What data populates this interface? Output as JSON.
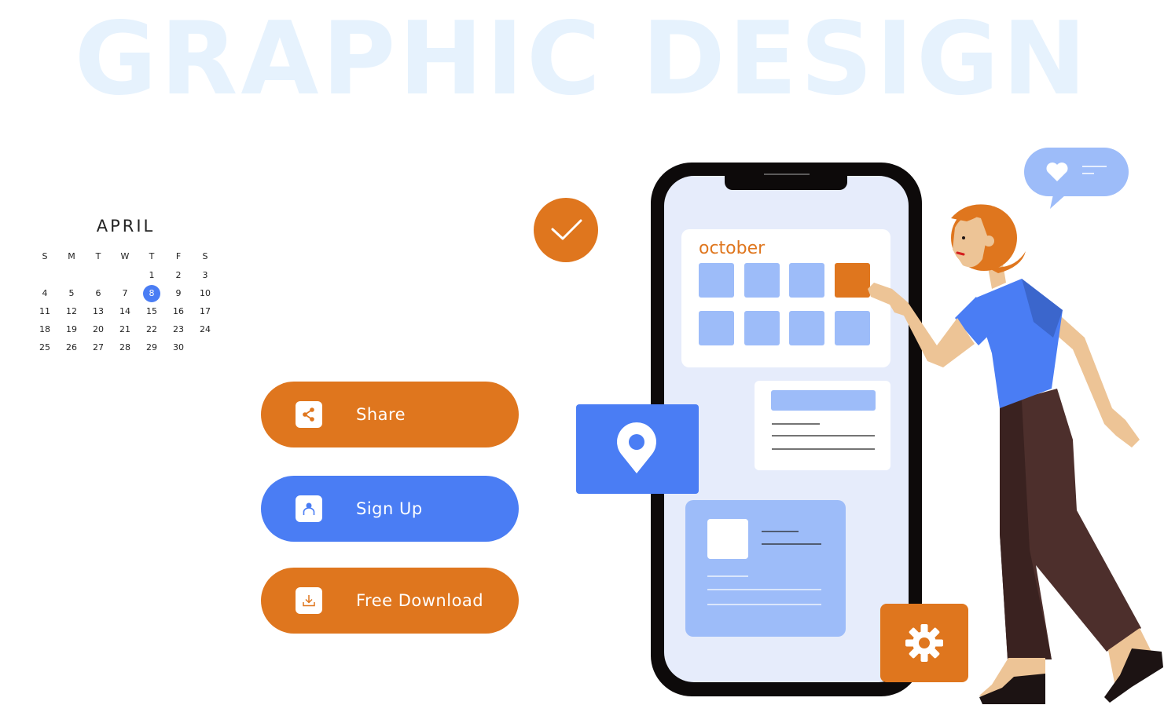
{
  "hero_text": "GRAPHIC DESIGN",
  "calendar": {
    "month": "APRIL",
    "weekdays": [
      "S",
      "M",
      "T",
      "W",
      "T",
      "F",
      "S"
    ],
    "days": [
      "",
      "",
      "",
      "",
      "1",
      "2",
      "3",
      "4",
      "5",
      "6",
      "7",
      "8",
      "9",
      "10",
      "11",
      "12",
      "13",
      "14",
      "15",
      "16",
      "17",
      "18",
      "19",
      "20",
      "21",
      "22",
      "23",
      "24",
      "25",
      "26",
      "27",
      "28",
      "29",
      "30"
    ],
    "selected_day": "8"
  },
  "buttons": {
    "share": {
      "label": "Share",
      "icon": "share-icon"
    },
    "signup": {
      "label": "Sign Up",
      "icon": "user-icon"
    },
    "download": {
      "label": "Free Download",
      "icon": "download-icon"
    }
  },
  "phone": {
    "month_label": "october"
  },
  "colors": {
    "orange": "#df761e",
    "blue": "#4a7df4",
    "light_blue": "#9dbcf9",
    "phone_screen": "#e6ecfb"
  }
}
